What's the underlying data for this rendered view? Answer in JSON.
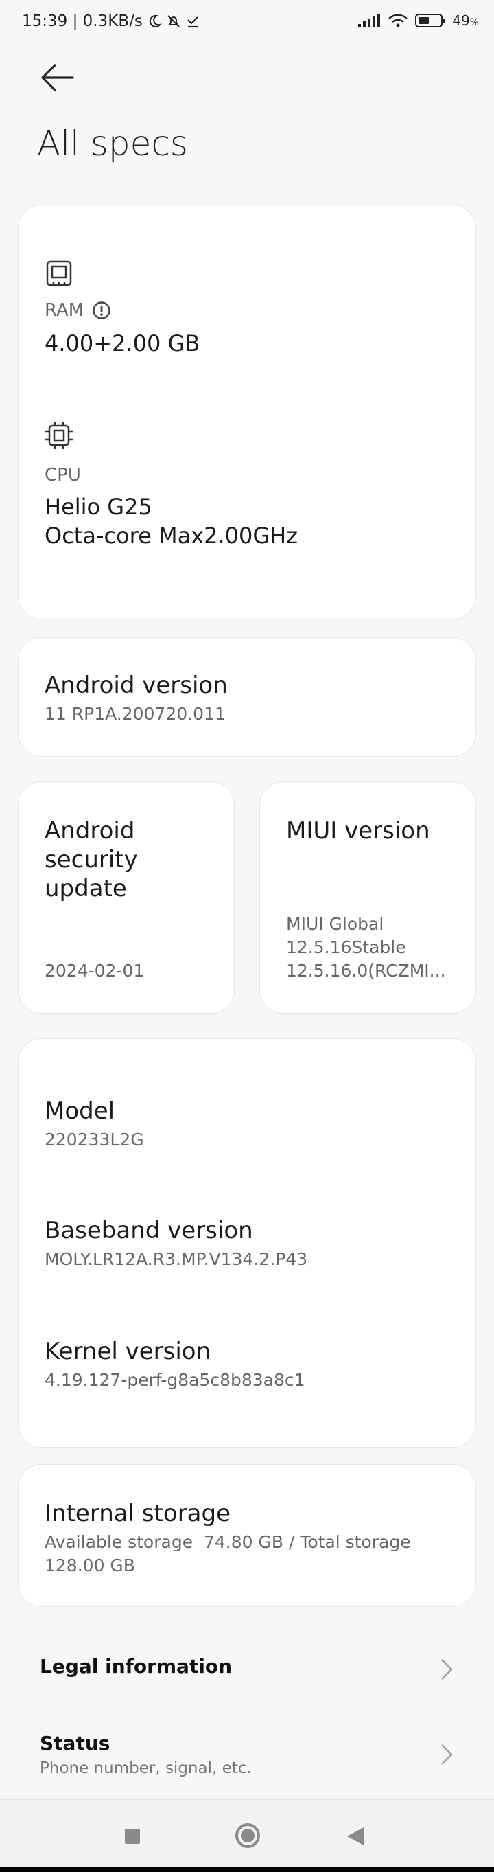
{
  "status_bar": {
    "time_speed": "15:39 | 0.3KB/s",
    "battery": "49"
  },
  "page": {
    "title": "All specs"
  },
  "hardware": {
    "ram_label": "RAM",
    "ram_value": "4.00+2.00 GB",
    "cpu_label": "CPU",
    "cpu_value_line1": "Helio G25",
    "cpu_value_line2": "Octa-core Max2.00GHz"
  },
  "android_version": {
    "title": "Android version",
    "value": "11 RP1A.200720.011"
  },
  "security_update": {
    "title_line1": "Android",
    "title_line2": "security",
    "title_line3": "update",
    "value": "2024-02-01"
  },
  "miui_version": {
    "title": "MIUI version",
    "value_line1": "MIUI Global",
    "value_line2": "12.5.16Stable",
    "value_line3": "12.5.16.0(RCZMI..."
  },
  "device_info": {
    "model_title": "Model",
    "model_value": "220233L2G",
    "baseband_title": "Baseband version",
    "baseband_value": "MOLY.LR12A.R3.MP.V134.2.P43",
    "kernel_title": "Kernel version",
    "kernel_value": "4.19.127-perf-g8a5c8b83a8c1"
  },
  "storage": {
    "title": "Internal storage",
    "value_line1": "Available storage  74.80 GB / Total storage",
    "value_line2": "128.00 GB"
  },
  "rows": {
    "legal_title": "Legal information",
    "status_title": "Status",
    "status_sub": "Phone number, signal, etc."
  },
  "icons": {
    "back": "arrow-left-icon",
    "ram": "memory-chip-icon",
    "cpu": "cpu-chip-icon",
    "info": "info-icon",
    "chevron": "chevron-right-icon"
  }
}
